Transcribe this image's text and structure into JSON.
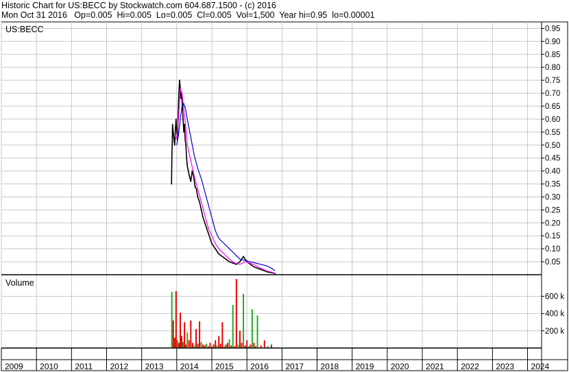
{
  "header": {
    "line1": "Historic Chart for US:BECC by Stockwatch.com 604.687.1500 - (c) 2016",
    "line2": "Mon Oct 31 2016   Op=0.005  Hi=0.005  Lo=0.005  Cl=0.005  Vol=1,500  Year hi=0.95  lo=0.00001"
  },
  "colors": {
    "price": "#000000",
    "ma_short": "#ff00ff",
    "ma_long": "#0000cc",
    "vol_up": "#22aa22",
    "vol_down": "#ee0000",
    "grid": "#c8c8c8"
  },
  "chart_data": [
    {
      "type": "line",
      "title": "US:BECC",
      "xlabel": "",
      "ylabel": "",
      "ylim": [
        0,
        0.975
      ],
      "xlim": [
        2009.0,
        2024.4
      ],
      "grid": true,
      "y_ticks": [
        "0.95",
        "0.90",
        "0.85",
        "0.80",
        "0.75",
        "0.70",
        "0.65",
        "0.60",
        "0.55",
        "0.50",
        "0.45",
        "0.40",
        "0.35",
        "0.30",
        "0.25",
        "0.20",
        "0.15",
        "0.10",
        "0.05"
      ],
      "y_tick_values": [
        0.95,
        0.9,
        0.85,
        0.8,
        0.75,
        0.7,
        0.65,
        0.6,
        0.55,
        0.5,
        0.45,
        0.4,
        0.35,
        0.3,
        0.25,
        0.2,
        0.15,
        0.1,
        0.05
      ],
      "x_ticks": [
        "2009",
        "2010",
        "2011",
        "2012",
        "2013",
        "2014",
        "2015",
        "2016",
        "2017",
        "2018",
        "2019",
        "2020",
        "2021",
        "2022",
        "2023",
        "2024"
      ],
      "x_tick_values": [
        2009,
        2010,
        2011,
        2012,
        2013,
        2014,
        2015,
        2016,
        2017,
        2018,
        2019,
        2020,
        2021,
        2022,
        2023,
        2024
      ],
      "series": [
        {
          "kind": "price",
          "x": [
            2013.85,
            2013.86,
            2013.87,
            2013.88,
            2013.9,
            2013.92,
            2013.94,
            2013.96,
            2013.98,
            2014.0,
            2014.02,
            2014.04,
            2014.06,
            2014.08,
            2014.1,
            2014.12,
            2014.14,
            2014.16,
            2014.18,
            2014.2,
            2014.22,
            2014.24,
            2014.26,
            2014.28,
            2014.3,
            2014.33,
            2014.36,
            2014.4,
            2014.44,
            2014.48,
            2014.52,
            2014.56,
            2014.6,
            2014.65,
            2014.7,
            2014.75,
            2014.8,
            2014.85,
            2014.9,
            2014.95,
            2015.0,
            2015.05,
            2015.1,
            2015.15,
            2015.2,
            2015.3,
            2015.4,
            2015.5,
            2015.6,
            2015.7,
            2015.8,
            2015.9,
            2016.0,
            2016.1,
            2016.2,
            2016.3,
            2016.4,
            2016.5,
            2016.6,
            2016.7,
            2016.8
          ],
          "y": [
            0.35,
            0.45,
            0.5,
            0.58,
            0.55,
            0.52,
            0.5,
            0.56,
            0.6,
            0.55,
            0.52,
            0.62,
            0.7,
            0.75,
            0.72,
            0.68,
            0.7,
            0.65,
            0.6,
            0.55,
            0.58,
            0.52,
            0.5,
            0.45,
            0.42,
            0.4,
            0.38,
            0.36,
            0.4,
            0.38,
            0.34,
            0.33,
            0.3,
            0.28,
            0.25,
            0.22,
            0.2,
            0.18,
            0.16,
            0.14,
            0.12,
            0.11,
            0.1,
            0.09,
            0.08,
            0.07,
            0.06,
            0.05,
            0.045,
            0.04,
            0.05,
            0.07,
            0.05,
            0.04,
            0.03,
            0.025,
            0.02,
            0.015,
            0.01,
            0.008,
            0.005
          ]
        },
        {
          "kind": "ma_short",
          "x": [
            2013.95,
            2014.0,
            2014.05,
            2014.1,
            2014.15,
            2014.2,
            2014.25,
            2014.3,
            2014.4,
            2014.5,
            2014.6,
            2014.7,
            2014.8,
            2014.9,
            2015.0,
            2015.1,
            2015.2,
            2015.35,
            2015.5,
            2015.65,
            2015.8,
            2015.95,
            2016.1,
            2016.25,
            2016.4,
            2016.55,
            2016.7,
            2016.8
          ],
          "y": [
            0.52,
            0.53,
            0.6,
            0.72,
            0.7,
            0.64,
            0.58,
            0.5,
            0.44,
            0.38,
            0.33,
            0.28,
            0.23,
            0.18,
            0.15,
            0.12,
            0.1,
            0.08,
            0.06,
            0.045,
            0.04,
            0.05,
            0.045,
            0.035,
            0.025,
            0.015,
            0.01,
            0.006
          ]
        },
        {
          "kind": "ma_long",
          "x": [
            2014.0,
            2014.05,
            2014.1,
            2014.15,
            2014.2,
            2014.25,
            2014.3,
            2014.4,
            2014.5,
            2014.6,
            2014.7,
            2014.8,
            2014.9,
            2015.0,
            2015.1,
            2015.2,
            2015.35,
            2015.5,
            2015.65,
            2015.8,
            2015.95,
            2016.1,
            2016.25,
            2016.4,
            2016.55,
            2016.7,
            2016.8
          ],
          "y": [
            0.5,
            0.54,
            0.6,
            0.65,
            0.66,
            0.64,
            0.6,
            0.53,
            0.46,
            0.41,
            0.37,
            0.32,
            0.27,
            0.22,
            0.17,
            0.14,
            0.12,
            0.1,
            0.08,
            0.06,
            0.055,
            0.05,
            0.045,
            0.04,
            0.035,
            0.025,
            0.015
          ]
        }
      ]
    },
    {
      "type": "bar",
      "title": "Volume",
      "xlabel": "",
      "ylabel": "",
      "ylim": [
        0,
        850000
      ],
      "grid": true,
      "y_ticks": [
        "600 k",
        "400 k",
        "200 k"
      ],
      "y_tick_values": [
        600000,
        400000,
        200000
      ],
      "series": [
        {
          "name": "",
          "x": [
            2013.86,
            2013.9,
            2013.94,
            2013.98,
            2014.02,
            2014.06,
            2014.1,
            2014.14,
            2014.18,
            2014.22,
            2014.26,
            2014.3,
            2014.35,
            2014.4,
            2014.45,
            2014.5,
            2014.55,
            2014.6,
            2014.65,
            2014.7,
            2014.75,
            2014.8,
            2014.85,
            2014.9,
            2014.95,
            2015.0,
            2015.05,
            2015.1,
            2015.15,
            2015.2,
            2015.25,
            2015.3,
            2015.35,
            2015.4,
            2015.45,
            2015.5,
            2015.55,
            2015.6,
            2015.65,
            2015.7,
            2015.75,
            2015.8,
            2015.85,
            2015.9,
            2015.95,
            2016.0,
            2016.05,
            2016.1,
            2016.15,
            2016.2,
            2016.25,
            2016.3,
            2016.4,
            2016.5,
            2016.6,
            2016.7
          ],
          "values": [
            650000,
            320000,
            120000,
            660000,
            90000,
            60000,
            410000,
            140000,
            70000,
            300000,
            40000,
            180000,
            90000,
            320000,
            60000,
            30000,
            220000,
            50000,
            310000,
            70000,
            40000,
            30000,
            50000,
            20000,
            60000,
            20000,
            40000,
            90000,
            30000,
            140000,
            50000,
            300000,
            20000,
            40000,
            60000,
            100000,
            30000,
            500000,
            20000,
            800000,
            40000,
            200000,
            60000,
            630000,
            30000,
            90000,
            20000,
            40000,
            450000,
            60000,
            20000,
            380000,
            30000,
            90000,
            20000,
            40000
          ],
          "up": [
            true,
            false,
            false,
            false,
            true,
            false,
            false,
            false,
            true,
            false,
            false,
            true,
            false,
            false,
            false,
            true,
            false,
            false,
            false,
            true,
            false,
            false,
            true,
            false,
            false,
            true,
            false,
            false,
            true,
            false,
            false,
            false,
            true,
            false,
            false,
            true,
            false,
            true,
            false,
            false,
            true,
            false,
            false,
            true,
            false,
            false,
            true,
            false,
            true,
            false,
            false,
            true,
            false,
            false,
            true,
            false
          ]
        }
      ]
    }
  ]
}
